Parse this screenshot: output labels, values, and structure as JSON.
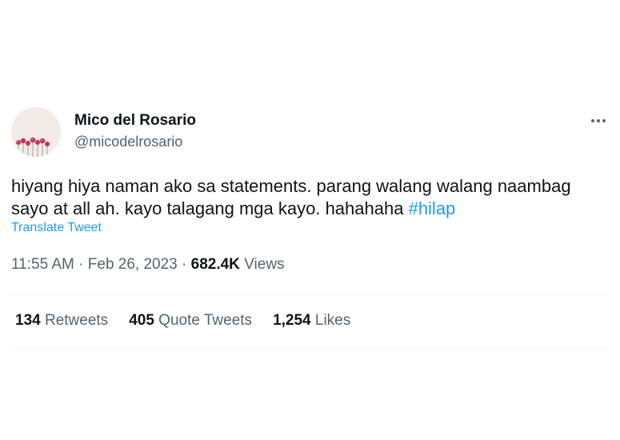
{
  "author": {
    "display_name": "Mico del Rosario",
    "handle": "@micodelrosario",
    "avatar_icon": "flower-avatar-icon"
  },
  "more_icon": "ellipsis-icon",
  "tweet": {
    "text_line1": "hiyang hiya naman ako sa statements. parang walang walang naambag",
    "text_line2_plain": "sayo at all ah. kayo talagang mga kayo. hahahaha ",
    "hashtag": "#hilap",
    "translate_label": "Translate Tweet"
  },
  "meta": {
    "time": "11:55 AM",
    "separator": "·",
    "date": "Feb 26, 2023",
    "views_count": "682.4K",
    "views_label": "Views"
  },
  "stats": {
    "retweets_count": "134",
    "retweets_label": "Retweets",
    "quotes_count": "405",
    "quotes_label": "Quote Tweets",
    "likes_count": "1,254",
    "likes_label": "Likes"
  },
  "colors": {
    "accent": "#1d9bf0",
    "text": "#0f1419",
    "secondary": "#536471",
    "divider": "#eff3f4"
  }
}
